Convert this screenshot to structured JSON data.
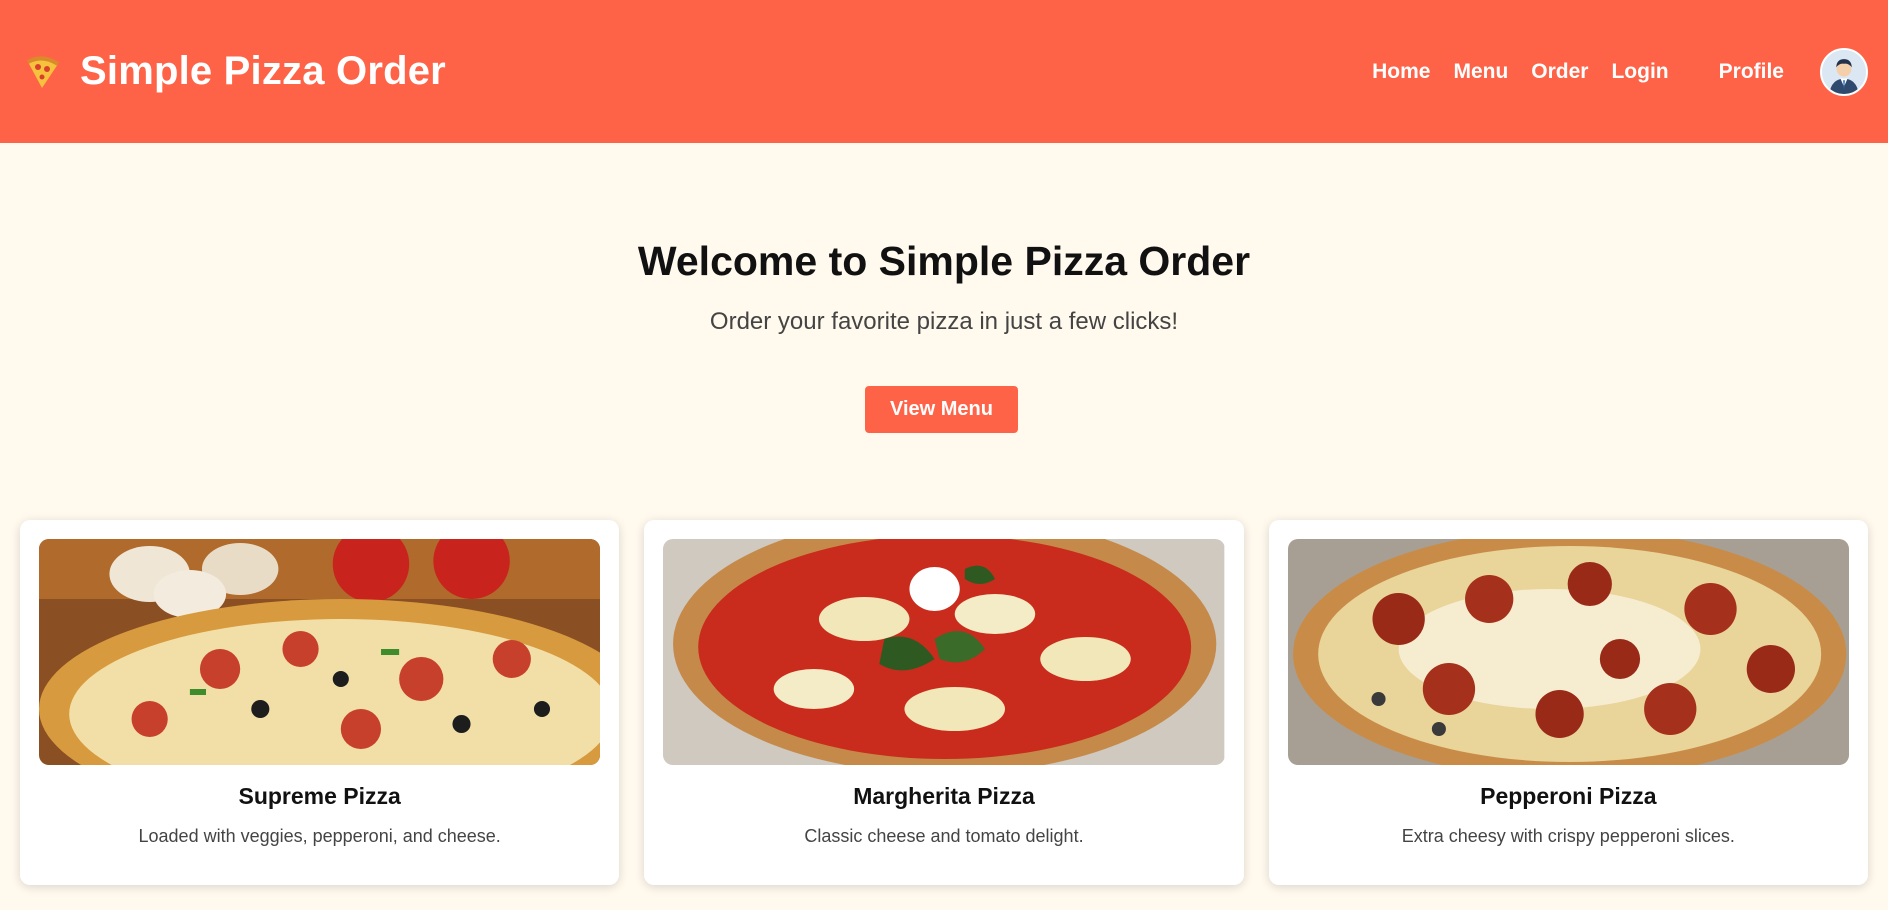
{
  "brand": {
    "title": "Simple Pizza Order",
    "logo_icon": "pizza-slice-icon"
  },
  "nav": {
    "items": [
      {
        "label": "Home"
      },
      {
        "label": "Menu"
      },
      {
        "label": "Order"
      },
      {
        "label": "Login"
      }
    ],
    "profile_label": "Profile",
    "avatar_icon": "user-avatar-icon"
  },
  "hero": {
    "title": "Welcome to Simple Pizza Order",
    "subtitle": "Order your favorite pizza in just a few clicks!",
    "cta_label": "View Menu"
  },
  "pizzas": [
    {
      "name": "Supreme Pizza",
      "description": "Loaded with veggies, pepperoni, and cheese.",
      "image_icon": "supreme-pizza-photo"
    },
    {
      "name": "Margherita Pizza",
      "description": "Classic cheese and tomato delight.",
      "image_icon": "margherita-pizza-photo"
    },
    {
      "name": "Pepperoni Pizza",
      "description": "Extra cheesy with crispy pepperoni slices.",
      "image_icon": "pepperoni-pizza-photo"
    }
  ],
  "colors": {
    "accent": "#ff6347",
    "background": "#fff9ee",
    "card": "#ffffff"
  }
}
